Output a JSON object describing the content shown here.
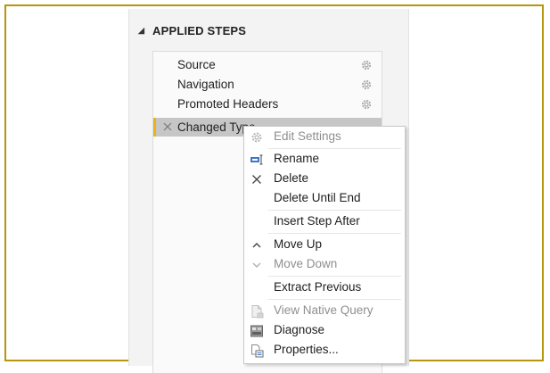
{
  "panel": {
    "title": "APPLIED STEPS"
  },
  "steps": [
    {
      "label": "Source",
      "has_gear": true
    },
    {
      "label": "Navigation",
      "has_gear": true
    },
    {
      "label": "Promoted Headers",
      "has_gear": true
    },
    {
      "label": "Changed Type",
      "selected": true
    }
  ],
  "context_menu": {
    "items": [
      {
        "label": "Edit Settings",
        "icon": "gear-icon",
        "disabled": true
      },
      {
        "label": "Rename",
        "icon": "rename-icon"
      },
      {
        "label": "Delete",
        "icon": "close-icon"
      },
      {
        "label": "Delete Until End"
      },
      {
        "label": "Insert Step After"
      },
      {
        "label": "Move Up",
        "icon": "chevron-up-icon"
      },
      {
        "label": "Move Down",
        "icon": "chevron-down-icon",
        "disabled": true
      },
      {
        "label": "Extract Previous"
      },
      {
        "label": "View Native Query",
        "icon": "native-query-icon",
        "disabled": true
      },
      {
        "label": "Diagnose",
        "icon": "diagnose-icon"
      },
      {
        "label": "Properties...",
        "icon": "properties-icon"
      }
    ]
  },
  "colors": {
    "accent": "#e8b419",
    "frame": "#b8960c",
    "selected_row": "#c6c6c6"
  }
}
